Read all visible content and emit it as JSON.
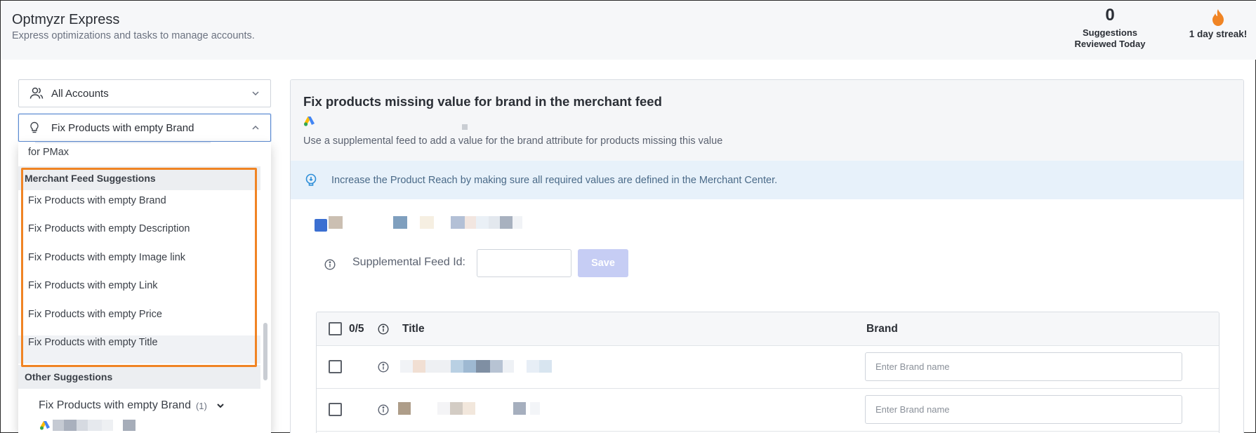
{
  "header": {
    "title": "Optmyzr Express",
    "subtitle": "Express optimizations and tasks to manage accounts.",
    "suggestions_count": "0",
    "suggestions_label_line1": "Suggestions",
    "suggestions_label_line2": "Reviewed Today",
    "streak_label": "1 day streak!"
  },
  "selectors": {
    "accounts": "All Accounts",
    "suggestion": "Fix Products with empty Brand"
  },
  "dropdown": {
    "partial_item": "for PMax",
    "group_merchant": "Merchant Feed Suggestions",
    "items": [
      "Fix Products with empty Brand",
      "Fix Products with empty Description",
      "Fix Products with empty Image link",
      "Fix Products with empty Link",
      "Fix Products with empty Price",
      "Fix Products with empty Title"
    ],
    "group_other": "Other Suggestions"
  },
  "sidebar_list": {
    "item_label": "Fix Products with empty Brand",
    "item_count": "(1)"
  },
  "card": {
    "title": "Fix products missing value for brand in the merchant feed",
    "description": "Use a supplemental feed to add a value for the brand attribute for products missing this value",
    "info": "Increase the Product Reach by making sure all required values are defined in the Merchant Center.",
    "feed_label": "Supplemental Feed Id:",
    "feed_value": "",
    "save_label": "Save"
  },
  "table": {
    "selected_count": "0/5",
    "col_title": "Title",
    "col_brand": "Brand",
    "brand_placeholder": "Enter Brand name"
  },
  "colors": {
    "accent_orange": "#f08424",
    "save_button": "#c6cdf4",
    "info_banner": "#e7f1fa",
    "flame": "#f08424"
  },
  "icons": [
    "people-icon",
    "lightbulb-icon",
    "chevron-down-icon",
    "chevron-up-icon",
    "flame-icon",
    "google-ads-icon",
    "info-icon"
  ]
}
